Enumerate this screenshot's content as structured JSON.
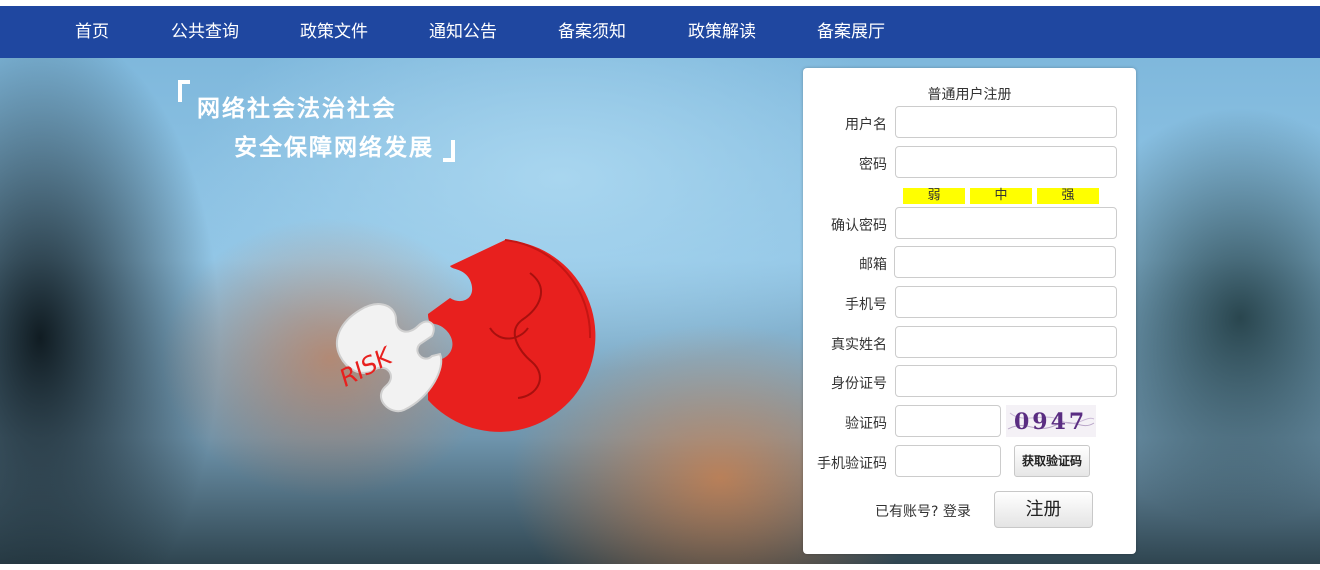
{
  "nav": {
    "items": [
      "首页",
      "公共查询",
      "政策文件",
      "通知公告",
      "备案须知",
      "政策解读",
      "备案展厅"
    ]
  },
  "hero": {
    "slogan_line1": "网络社会法治社会",
    "slogan_line2": "安全保障网络发展",
    "puzzle_text": "RISK"
  },
  "form": {
    "title": "普通用户注册",
    "labels": {
      "username": "用户名",
      "password": "密码",
      "confirm_password": "确认密码",
      "email": "邮箱",
      "phone": "手机号",
      "real_name": "真实姓名",
      "id_number": "身份证号",
      "captcha": "验证码",
      "sms_code": "手机验证码"
    },
    "strength": [
      "弱",
      "中",
      "强"
    ],
    "captcha_text": "0947",
    "sms_button": "获取验证码",
    "login_prompt": "已有账号? 登录",
    "register_button": "注册"
  },
  "colors": {
    "nav_bg": "#1f47a0",
    "strength_bg": "#ffff00",
    "puzzle_red": "#e8201e"
  }
}
